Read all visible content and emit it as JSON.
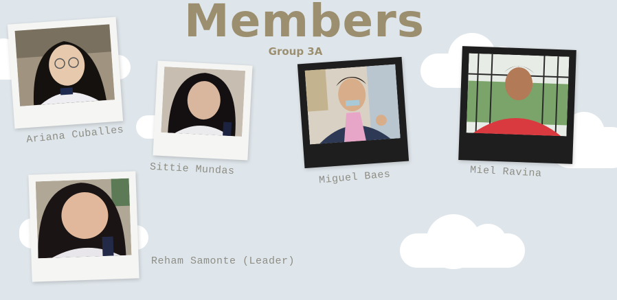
{
  "header": {
    "title": "Members",
    "subtitle": "Group 3A"
  },
  "members": [
    {
      "name": "Ariana Cuballes"
    },
    {
      "name": "Sittie Mundas"
    },
    {
      "name": "Miguel Baes"
    },
    {
      "name": "Miel Ravina"
    },
    {
      "name": "Reham Samonte (Leader)"
    }
  ],
  "colors": {
    "background": "#dfe6eb",
    "title": "#9c8f70",
    "name_text": "#8d8d84"
  }
}
